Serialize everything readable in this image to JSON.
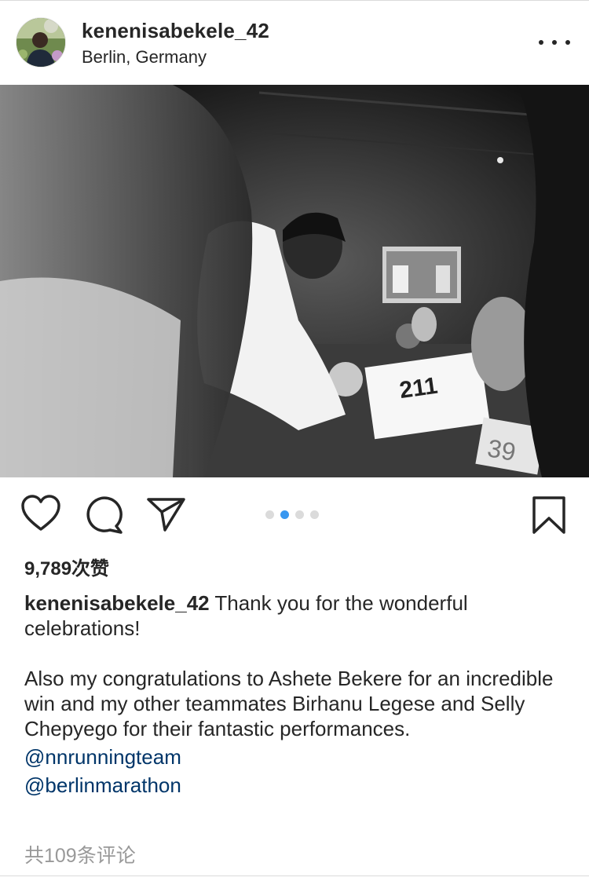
{
  "post": {
    "username": "kenenisabekele_42",
    "location": "Berlin, Germany",
    "likes": "9,789次赞",
    "caption_user": "kenenisabekele_42",
    "caption_line1": " Thank you for the wonderful celebrations!",
    "caption_para2": "Also my congratulations to Ashete Bekere for an incredible win and my other teammates Birhanu Legese and Selly Chepyego for their fantastic performances.",
    "mentions": [
      "@nnrunningteam",
      "@berlinmarathon"
    ],
    "comments_link": "共109条评论"
  },
  "carousel": {
    "total": 4,
    "active_index": 1
  },
  "colors": {
    "text": "#262626",
    "link": "#003569",
    "muted": "#999999",
    "accent": "#3897f0",
    "border": "#dbdbdb"
  },
  "icons": [
    "more-options-icon",
    "heart-icon",
    "comment-icon",
    "share-icon",
    "bookmark-icon"
  ]
}
